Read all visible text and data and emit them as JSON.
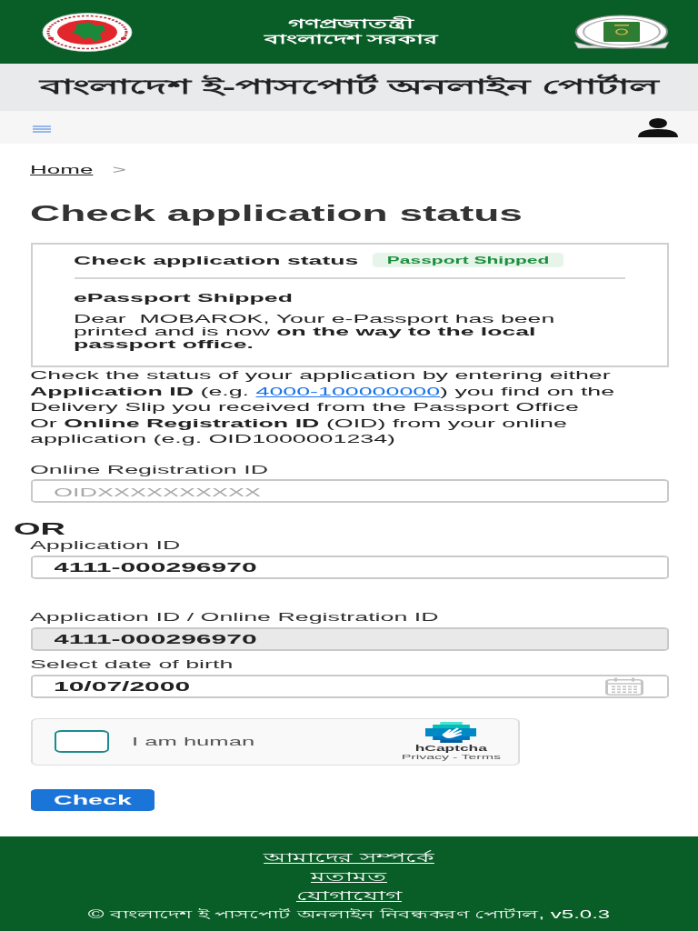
{
  "header": {
    "title_lines": [
      "গণপ্রজাতন্ত্রী",
      "বাংলাদেশ সরকার"
    ]
  },
  "portal_banner": {
    "title": "বাংলাদেশ ই-পাসপোর্ট অনলাইন পোর্টাল"
  },
  "breadcrumb": {
    "items": [
      "Home"
    ],
    "separator": ">"
  },
  "page_title": "Check application status",
  "status_card": {
    "title": "Check application status",
    "badge": "Passport Shipped",
    "heading": "ePassport Shipped",
    "message": "Dear  MOBAROK, Your e-Passport has been printed and is now **on the way to the local passport office.**"
  },
  "instructions": {
    "before_link": "Check the status of your application by entering either **Application ID** (e.g. ",
    "link": "4000-100000000",
    "after_link": ") you find on the Delivery Slip you received from the Passport Office",
    "second_line": "Or **Online Registration ID** (OID) from your online application (e.g. OID1000001234)"
  },
  "id_inputs": [
    {
      "kind": "field",
      "label": "Online Registration ID",
      "placeholder": "OIDXXXXXXXXXX",
      "disabled": false
    },
    {
      "kind": "separator",
      "text": "OR"
    },
    {
      "kind": "field",
      "label": "Application ID",
      "value": "4111-000296970",
      "disabled": false
    }
  ],
  "verification_inputs": [
    {
      "kind": "field",
      "label": "Application ID / Online Registration ID",
      "value": "4111-000296970",
      "disabled": true
    },
    {
      "kind": "date",
      "label": "Select date of birth",
      "value": "10/07/2000",
      "disabled": false
    }
  ],
  "captcha": {
    "checked": false,
    "label": "I am human",
    "brand": "hCaptcha",
    "privacy_link": "Privacy",
    "separator": "-",
    "terms_link": "Terms"
  },
  "submit_button": {
    "label": "Check"
  },
  "footer": {
    "links": [
      "আমাদের সম্পর্কে",
      "মতামত",
      "যোগাযোগ"
    ],
    "copyright": "© বাংলাদেশ ই পাসপোর্ট অনলাইন নিবন্ধকরণ পোর্টাল, v5.0.3"
  }
}
